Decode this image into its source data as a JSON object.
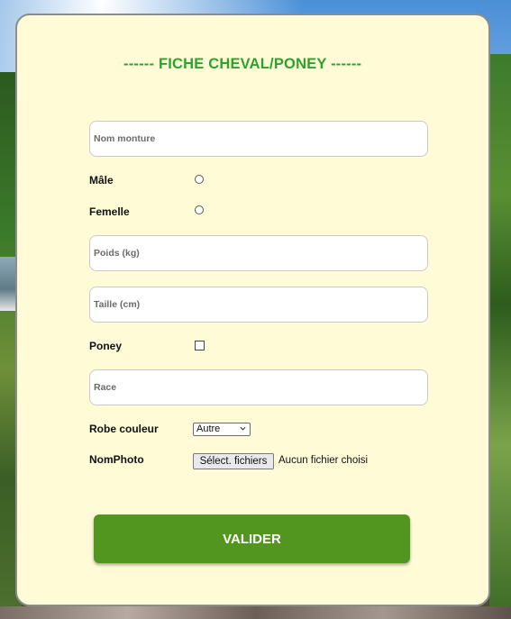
{
  "form": {
    "title": "------ FICHE CHEVAL/PONEY ------",
    "nom_monture": {
      "placeholder": "Nom monture",
      "value": ""
    },
    "male_label": "Mâle",
    "femelle_label": "Femelle",
    "poids": {
      "placeholder": "Poids (kg)",
      "value": ""
    },
    "taille": {
      "placeholder": "Taille (cm)",
      "value": ""
    },
    "poney_label": "Poney",
    "race": {
      "placeholder": "Race",
      "value": ""
    },
    "robe_label": "Robe couleur",
    "robe_selected": "Autre",
    "photo_label": "NomPhoto",
    "file_button_label": "Sélect. fichiers",
    "file_status": "Aucun fichier choisi",
    "submit_label": "VALIDER"
  },
  "colors": {
    "card_background": "#fffbd6",
    "title": "#2ea12e",
    "submit": "#529620"
  }
}
